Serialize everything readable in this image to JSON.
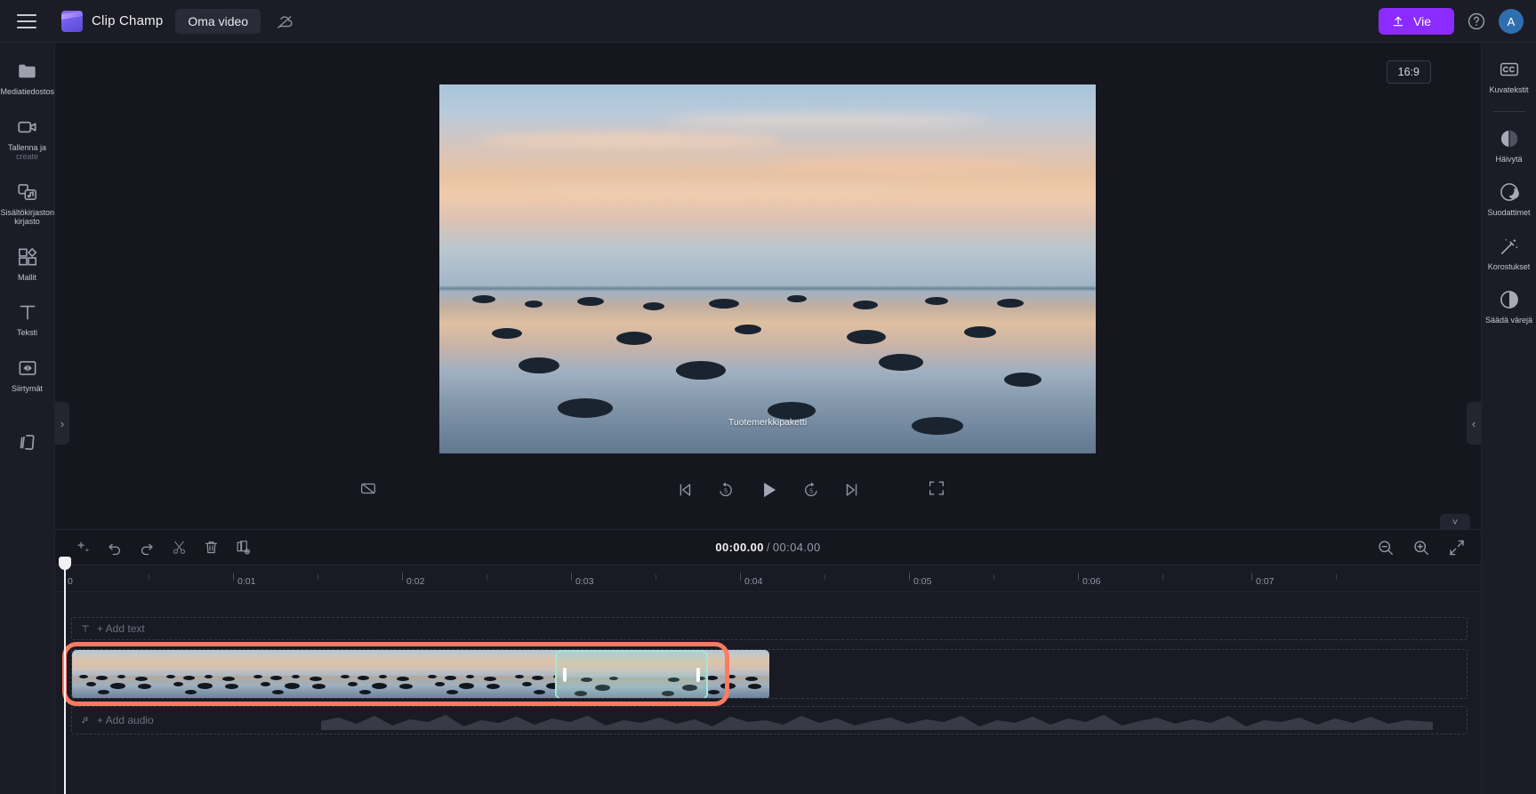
{
  "app": {
    "brand": "Clip Champ",
    "project_name": "Oma video",
    "export_label": "Vie",
    "avatar_initial": "A"
  },
  "icons": {
    "hamburger": "hamburger-menu-icon",
    "logo": "clipchamp-logo-icon",
    "cloud_off": "cloud-off-icon",
    "upload": "upload-arrow-icon",
    "help": "help-circle-icon"
  },
  "left_sidebar": {
    "items": [
      {
        "label": "Mediatiedostosi",
        "icon": "folder-icon",
        "dim": false
      },
      {
        "label": "Tallenna ja",
        "sub": "create",
        "icon": "video-camera-icon",
        "dim": false
      },
      {
        "label": "Sisältökirjaston",
        "sub": "kirjasto",
        "icon": "content-library-icon",
        "dim": false
      },
      {
        "label": "Mallit",
        "icon": "templates-grid-icon",
        "dim": false
      },
      {
        "label": "Teksti",
        "icon": "text-t-icon",
        "dim": false
      },
      {
        "label": "Siirtymät",
        "icon": "transitions-icon",
        "dim": false
      },
      {
        "label": "",
        "icon": "brand-kit-icon",
        "dim": false
      }
    ]
  },
  "right_sidebar": {
    "items": [
      {
        "label": "Kuvatekstit",
        "icon": "closed-captions-icon"
      },
      {
        "label": "Häivytä",
        "icon": "fade-icon"
      },
      {
        "label": "Suodattimet",
        "icon": "filters-icon"
      },
      {
        "label": "Korostukset",
        "icon": "effects-wand-icon"
      },
      {
        "label": "Säädä värejä",
        "icon": "adjust-colors-icon"
      }
    ]
  },
  "preview": {
    "aspect_ratio": "16:9",
    "caption_overlay": "Tuotemerkkipaketti",
    "controls": [
      {
        "name": "captions-off-icon",
        "title": ""
      },
      {
        "name": "skip-to-start-icon",
        "title": ""
      },
      {
        "name": "rewind-5-icon",
        "title": "5"
      },
      {
        "name": "play-icon",
        "title": ""
      },
      {
        "name": "forward-5-icon",
        "title": "5"
      },
      {
        "name": "skip-to-end-icon",
        "title": ""
      },
      {
        "name": "fullscreen-icon",
        "title": ""
      }
    ]
  },
  "timeline": {
    "toolbar_icons": [
      "magic-sparkle-icon",
      "undo-icon",
      "redo-icon",
      "split-scissors-icon",
      "delete-trash-icon",
      "duplicate-icon"
    ],
    "zoom_icons": [
      "zoom-out-icon",
      "zoom-in-icon",
      "fit-to-screen-icon"
    ],
    "current_time": "00:00.00",
    "separator": "/",
    "total_time": "00:04.00",
    "ruler_labels": [
      "0",
      "0:01",
      "0:02",
      "0:03",
      "0:04",
      "0:05",
      "0:06",
      "0:07"
    ],
    "add_text_label": "+ Add text",
    "add_text_icon": "text-t-icon",
    "add_audio_label": "+ Add audio",
    "add_audio_icon": "music-note-icon",
    "selected_clip_name": "video-clip-selected",
    "highlight_color": "#ff7a63",
    "selection_color": "#a6e6d2"
  },
  "colors": {
    "accent_purple": "#8b2bff",
    "panel_bg": "#1c1c26",
    "canvas_bg": "#16161f",
    "avatar_blue": "#2f6fb0"
  }
}
